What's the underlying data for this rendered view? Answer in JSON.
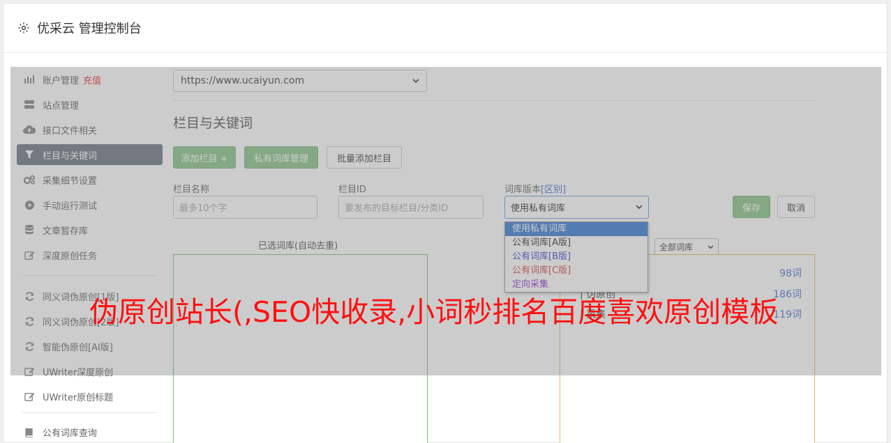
{
  "header": {
    "title": "优采云 管理控制台",
    "icon": "gear-icon"
  },
  "sidebar": {
    "items": [
      {
        "label": "账户管理",
        "icon": "bar-chart-icon",
        "badge": "充值"
      },
      {
        "label": "站点管理",
        "icon": "server-icon"
      },
      {
        "label": "接口文件相关",
        "icon": "cloud-upload-icon"
      },
      {
        "label": "栏目与关键词",
        "icon": "filter-icon",
        "active": true
      },
      {
        "label": "采集细节设置",
        "icon": "gears-icon"
      },
      {
        "label": "手动运行测试",
        "icon": "play-icon"
      },
      {
        "label": "文章暂存库",
        "icon": "database-icon"
      },
      {
        "label": "深度原创任务",
        "icon": "edit-icon"
      }
    ],
    "items2": [
      {
        "label": "同义词伪原创[1版]",
        "icon": "refresh-icon"
      },
      {
        "label": "同义词伪原创[2版]",
        "icon": "refresh-icon"
      },
      {
        "label": "智能伪原创[AI版]",
        "icon": "refresh-icon"
      },
      {
        "label": "UWriter深度原创",
        "icon": "edit-icon"
      },
      {
        "label": "UWriter原创标题",
        "icon": "edit-icon"
      }
    ],
    "items3": [
      {
        "label": "公有词库查询",
        "icon": "book-icon"
      }
    ]
  },
  "main": {
    "site_select": "https://www.ucaiyun.com",
    "section_title": "栏目与关键词",
    "buttons": {
      "add_column": "添加栏目 +",
      "private_lib": "私有词库管理",
      "batch_add": "批量添加栏目",
      "save": "保存",
      "cancel": "取消"
    },
    "fields": {
      "column_name_label": "栏目名称",
      "column_name_placeholder": "最多10个字",
      "column_id_label": "栏目ID",
      "column_id_placeholder": "要发布的目标栏目/分类ID",
      "lib_version_label": "词库版本",
      "lib_version_link": "[区别]",
      "lib_version_value": "使用私有词库"
    },
    "dropdown_options": [
      {
        "label": "使用私有词库",
        "color": "#ffffff",
        "selected": true
      },
      {
        "label": "公有词库[A版]",
        "color": "#333333"
      },
      {
        "label": "公有词库[B版]",
        "color": "#3b4cd0"
      },
      {
        "label": "公有词库[C版]",
        "color": "#d04848"
      },
      {
        "label": "定向采集",
        "color": "#8a3bc9"
      }
    ],
    "selected_panel_title": "已选词库(自动去重)",
    "filter_select": "全部词库",
    "library_rows": [
      {
        "name": "",
        "count": "98词"
      },
      {
        "name": "| 伪原创",
        "count": "186词"
      },
      {
        "name": "| 采集",
        "count": "119词"
      }
    ]
  },
  "watermark": "伪原创站长(,SEO快收录,小词秒排名百度喜欢原创模板",
  "colors": {
    "active_nav": "#6f7a86",
    "green_button": "#8cc58c",
    "badge": "#e53935",
    "watermark": "#ff1010"
  }
}
